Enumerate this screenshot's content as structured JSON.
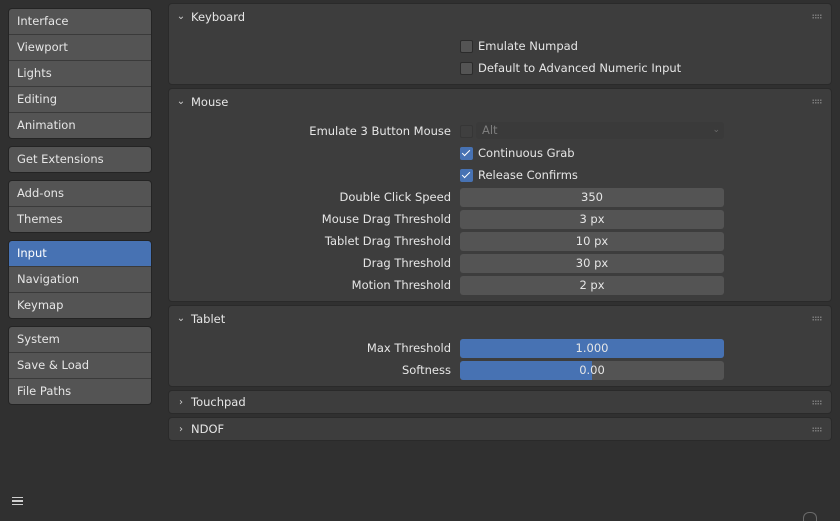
{
  "sidebar": {
    "groups": [
      [
        "Interface",
        "Viewport",
        "Lights",
        "Editing",
        "Animation"
      ],
      [
        "Get Extensions"
      ],
      [
        "Add-ons",
        "Themes"
      ],
      [
        "Input",
        "Navigation",
        "Keymap"
      ],
      [
        "System",
        "Save & Load",
        "File Paths"
      ]
    ],
    "active": "Input"
  },
  "keyboard": {
    "title": "Keyboard",
    "emulate_numpad": {
      "label": "Emulate Numpad",
      "checked": false
    },
    "advanced_numeric": {
      "label": "Default to Advanced Numeric Input",
      "checked": false
    }
  },
  "mouse": {
    "title": "Mouse",
    "emulate3": {
      "label": "Emulate 3 Button Mouse",
      "checked": false,
      "modifier": "Alt"
    },
    "continuous_grab": {
      "label": "Continuous Grab",
      "checked": true
    },
    "release_confirms": {
      "label": "Release Confirms",
      "checked": true
    },
    "double_click": {
      "label": "Double Click Speed",
      "value": "350"
    },
    "mouse_drag": {
      "label": "Mouse Drag Threshold",
      "value": "3 px"
    },
    "tablet_drag": {
      "label": "Tablet Drag Threshold",
      "value": "10 px"
    },
    "drag": {
      "label": "Drag Threshold",
      "value": "30 px"
    },
    "motion": {
      "label": "Motion Threshold",
      "value": "2 px"
    }
  },
  "tablet": {
    "title": "Tablet",
    "max_threshold": {
      "label": "Max Threshold",
      "value": "1.000",
      "fraction": 1.0
    },
    "softness": {
      "label": "Softness",
      "value": "0.00",
      "fraction": 0.5
    }
  },
  "touchpad": {
    "title": "Touchpad"
  },
  "ndof": {
    "title": "NDOF"
  },
  "colors": {
    "accent": "#4772b3",
    "panel": "#3d3d3d",
    "background": "#303030"
  }
}
